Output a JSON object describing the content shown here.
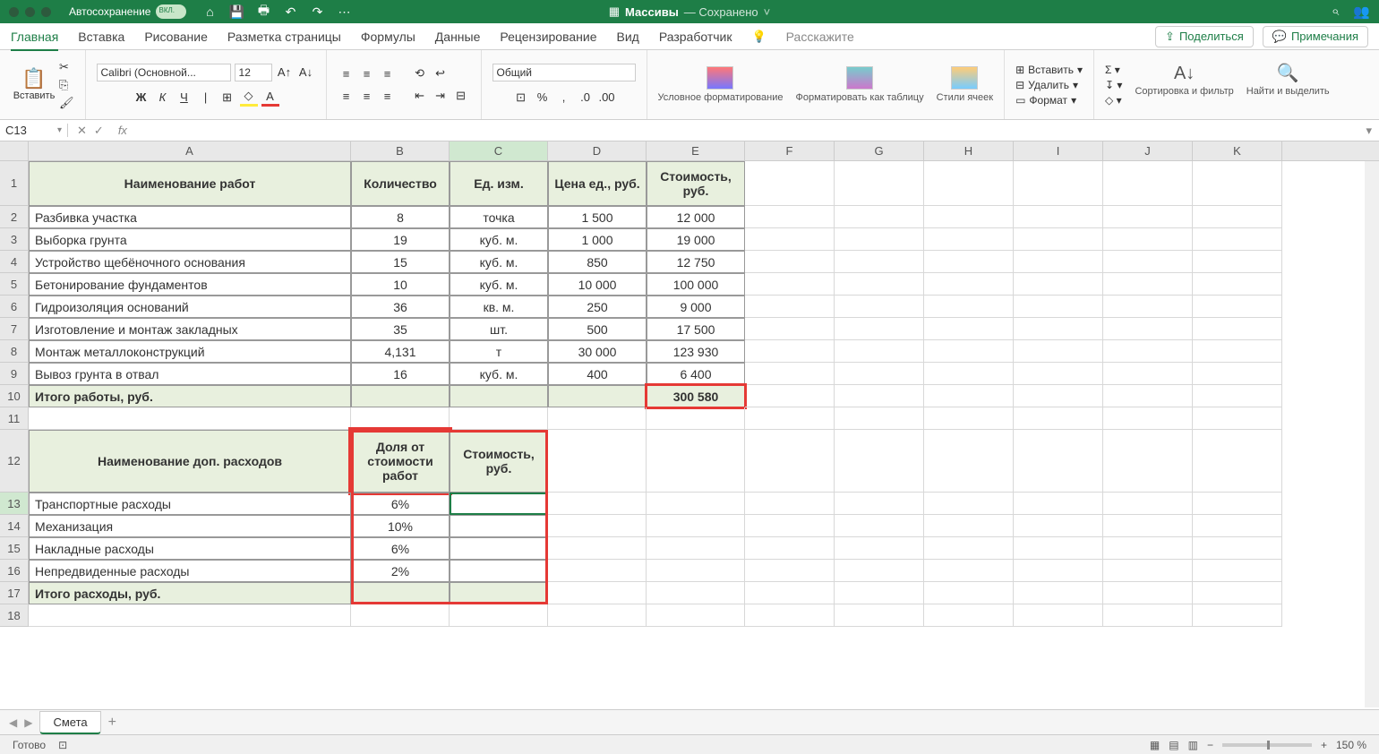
{
  "titlebar": {
    "autosave_label": "Автосохранение",
    "doc_title": "Массивы",
    "doc_status": "— Сохранено"
  },
  "tabs": [
    "Главная",
    "Вставка",
    "Рисование",
    "Разметка страницы",
    "Формулы",
    "Данные",
    "Рецензирование",
    "Вид",
    "Разработчик"
  ],
  "tell_me": "Расскажите",
  "share": "Поделиться",
  "comments": "Примечания",
  "ribbon": {
    "paste": "Вставить",
    "font_name": "Calibri (Основной...",
    "font_size": "12",
    "number_format": "Общий",
    "cond_format": "Условное форматирование",
    "format_table": "Форматировать как таблицу",
    "cell_styles": "Стили ячеек",
    "insert": "Вставить",
    "delete": "Удалить",
    "format": "Формат",
    "sort_filter": "Сортировка и фильтр",
    "find_select": "Найти и выделить"
  },
  "namebox": "C13",
  "columns": [
    "A",
    "B",
    "C",
    "D",
    "E",
    "F",
    "G",
    "H",
    "I",
    "J",
    "K"
  ],
  "headers1": {
    "A": "Наименование работ",
    "B": "Количество",
    "C": "Ед. изм.",
    "D": "Цена ед., руб.",
    "E": "Стоимость, руб."
  },
  "works": [
    {
      "n": "Разбивка участка",
      "q": "8",
      "u": "точка",
      "p": "1 500",
      "c": "12 000"
    },
    {
      "n": "Выборка грунта",
      "q": "19",
      "u": "куб. м.",
      "p": "1 000",
      "c": "19 000"
    },
    {
      "n": "Устройство щебёночного основания",
      "q": "15",
      "u": "куб. м.",
      "p": "850",
      "c": "12 750"
    },
    {
      "n": "Бетонирование фундаментов",
      "q": "10",
      "u": "куб. м.",
      "p": "10 000",
      "c": "100 000"
    },
    {
      "n": "Гидроизоляция оснований",
      "q": "36",
      "u": "кв. м.",
      "p": "250",
      "c": "9 000"
    },
    {
      "n": "Изготовление и монтаж закладных",
      "q": "35",
      "u": "шт.",
      "p": "500",
      "c": "17 500"
    },
    {
      "n": "Монтаж металлоконструкций",
      "q": "4,131",
      "u": "т",
      "p": "30 000",
      "c": "123 930"
    },
    {
      "n": "Вывоз грунта в отвал",
      "q": "16",
      "u": "куб. м.",
      "p": "400",
      "c": "6 400"
    }
  ],
  "total_works_label": "Итого работы, руб.",
  "total_works_value": "300 580",
  "headers2": {
    "A": "Наименование доп. расходов",
    "B": "Доля от стоимости работ",
    "C": "Стоимость, руб."
  },
  "expenses": [
    {
      "n": "Транспортные расходы",
      "p": "6%"
    },
    {
      "n": "Механизация",
      "p": "10%"
    },
    {
      "n": "Накладные расходы",
      "p": "6%"
    },
    {
      "n": "Непредвиденные расходы",
      "p": "2%"
    }
  ],
  "total_exp_label": "Итого расходы, руб.",
  "sheet_tab": "Смета",
  "status": "Готово",
  "zoom": "150 %"
}
